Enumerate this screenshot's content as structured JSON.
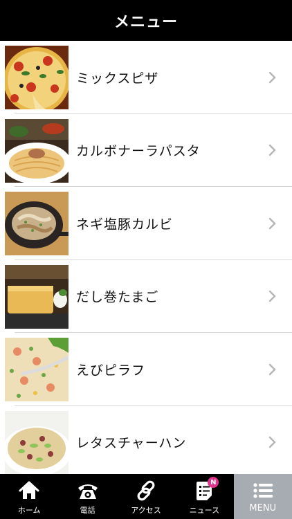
{
  "header": {
    "title": "メニュー"
  },
  "menu": {
    "items": [
      {
        "label": "ミックスピザ",
        "icon": "chevron-right-icon"
      },
      {
        "label": "カルボナーラパスタ",
        "icon": "chevron-right-icon"
      },
      {
        "label": "ネギ塩豚カルビ",
        "icon": "chevron-right-icon"
      },
      {
        "label": "だし巻たまご",
        "icon": "chevron-right-icon"
      },
      {
        "label": "えびピラフ",
        "icon": "chevron-right-icon"
      },
      {
        "label": "レタスチャーハン",
        "icon": "chevron-right-icon"
      }
    ]
  },
  "tabbar": {
    "tabs": [
      {
        "label": "ホーム",
        "icon": "home-icon"
      },
      {
        "label": "電話",
        "icon": "phone-icon"
      },
      {
        "label": "アクセス",
        "icon": "link-icon"
      },
      {
        "label": "ニュース",
        "icon": "news-icon",
        "badge": "N"
      },
      {
        "label": "MENU",
        "icon": "menu-list-icon",
        "active": true
      }
    ]
  },
  "colors": {
    "header_bg": "#000000",
    "tabbar_bg": "#000000",
    "active_tab_bg": "#a6acb2",
    "badge": "#e0338c",
    "chevron": "#b5b5b5"
  }
}
